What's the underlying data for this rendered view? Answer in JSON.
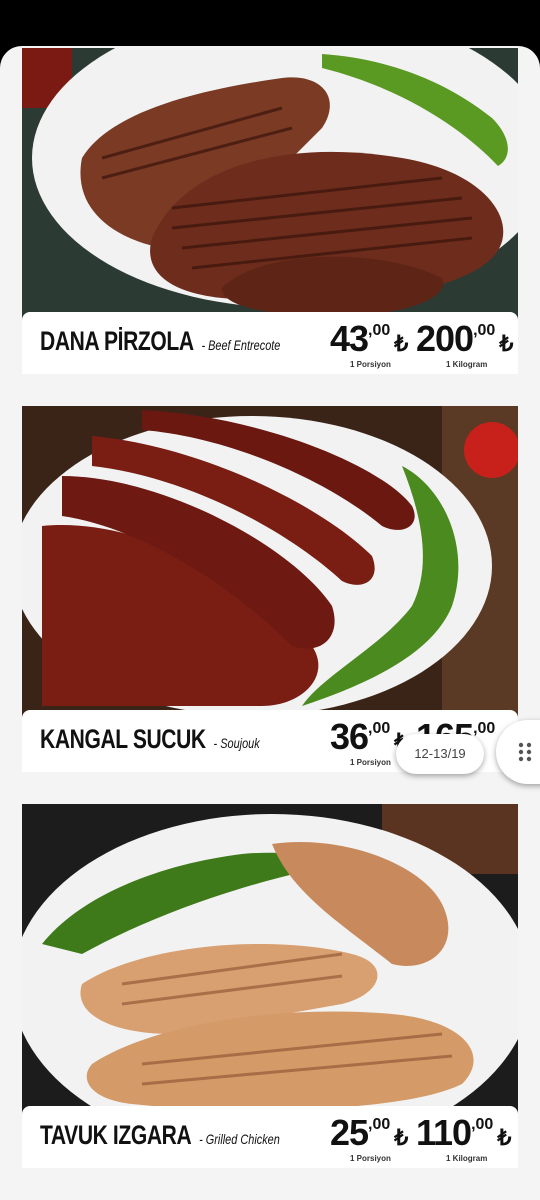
{
  "items": [
    {
      "name": "DANA PİRZOLA",
      "subtitle": "- Beef Entrecote",
      "price1_main": "43",
      "price1_dec": ",00",
      "price1_unit": "1 Porsiyon",
      "price2_main": "200",
      "price2_dec": ",00",
      "price2_unit": "1 Kilogram",
      "currency": "₺"
    },
    {
      "name": "KANGAL SUCUK",
      "subtitle": "- Soujouk",
      "price1_main": "36",
      "price1_dec": ",00",
      "price1_unit": "1 Porsiyon",
      "price2_main": "165",
      "price2_dec": ",00",
      "price2_unit": "",
      "currency": "₺"
    },
    {
      "name": "TAVUK IZGARA",
      "subtitle": "- Grilled Chicken",
      "price1_main": "25",
      "price1_dec": ",00",
      "price1_unit": "1 Porsiyon",
      "price2_main": "110",
      "price2_dec": ",00",
      "price2_unit": "1 Kilogram",
      "currency": "₺"
    }
  ],
  "date_chip": "12-13/19",
  "icons": {
    "drag_handle": "grip-dots-icon"
  }
}
